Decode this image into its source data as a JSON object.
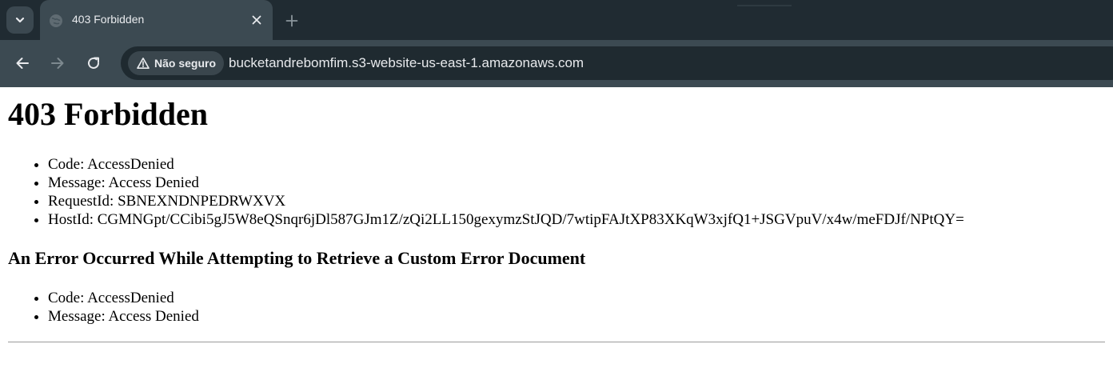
{
  "browser": {
    "tab": {
      "title": "403 Forbidden"
    },
    "security": {
      "label": "Não seguro"
    },
    "url": "bucketandrebomfim.s3-website-us-east-1.amazonaws.com"
  },
  "page": {
    "heading": "403 Forbidden",
    "details": [
      "Code: AccessDenied",
      "Message: Access Denied",
      "RequestId: SBNEXNDNPEDRWXVX",
      "HostId: CGMNGpt/CCibi5gJ5W8eQSnqr6jDl587GJm1Z/zQi2LL150gexymzStJQD/7wtipFAJtXP83XKqW3xjfQ1+JSGVpuV/x4w/meFDJf/NPtQY="
    ],
    "error_doc_heading": "An Error Occurred While Attempting to Retrieve a Custom Error Document",
    "error_doc_details": [
      "Code: AccessDenied",
      "Message: Access Denied"
    ]
  },
  "icons": {
    "tab_search": "chevron-down-icon",
    "favicon": "globe-icon",
    "tab_close": "close-icon",
    "new_tab": "plus-icon",
    "back": "arrow-left-icon",
    "forward": "arrow-right-icon",
    "reload": "reload-icon",
    "security": "warning-icon"
  },
  "colors": {
    "tabstrip_bg": "#202b32",
    "toolbar_bg": "#3c4a52",
    "omnibox_bg": "#1f2a30",
    "chrome_text": "#e8eaed",
    "page_bg": "#ffffff"
  }
}
